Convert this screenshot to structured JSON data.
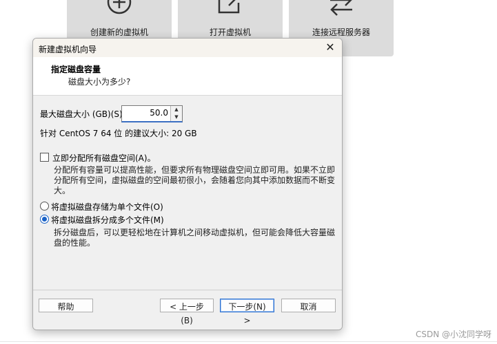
{
  "home": {
    "tiles": [
      {
        "label": "创建新的虚拟机",
        "icon": "plus-circle-icon"
      },
      {
        "label": "打开虚拟机",
        "icon": "open-folder-icon"
      },
      {
        "label": "连接远程服务器",
        "icon": "remote-connect-icon"
      }
    ]
  },
  "dialog": {
    "title": "新建虚拟机向导",
    "header": {
      "title": "指定磁盘容量",
      "subtitle": "磁盘大小为多少?"
    },
    "max_size_label": "最大磁盘大小 (GB)(S):",
    "max_size_value": "50.0",
    "recommend": "针对 CentOS 7 64 位 的建议大小: 20 GB",
    "allocate_all_label": "立即分配所有磁盘空间(A)。",
    "allocate_all_checked": false,
    "allocate_desc": "分配所有容量可以提高性能，但要求所有物理磁盘空间立即可用。如果不立即分配所有空间，虚拟磁盘的空间最初很小，会随着您向其中添加数据而不断变大。",
    "single_file_label": "将虚拟磁盘存储为单个文件(O)",
    "multi_file_label": "将虚拟磁盘拆分成多个文件(M)",
    "selected_option": "multi",
    "split_desc": "拆分磁盘后，可以更轻松地在计算机之间移动虚拟机，但可能会降低大容量磁盘的性能。",
    "buttons": {
      "help": "帮助",
      "back": "< 上一步(B)",
      "next": "下一步(N) >",
      "cancel": "取消"
    }
  },
  "watermark": "CSDN @小沈同学呀",
  "colors": {
    "accent": "#1a62c6",
    "tile_bg": "#dcdcdc",
    "dialog_bg": "#f0f0f0"
  }
}
